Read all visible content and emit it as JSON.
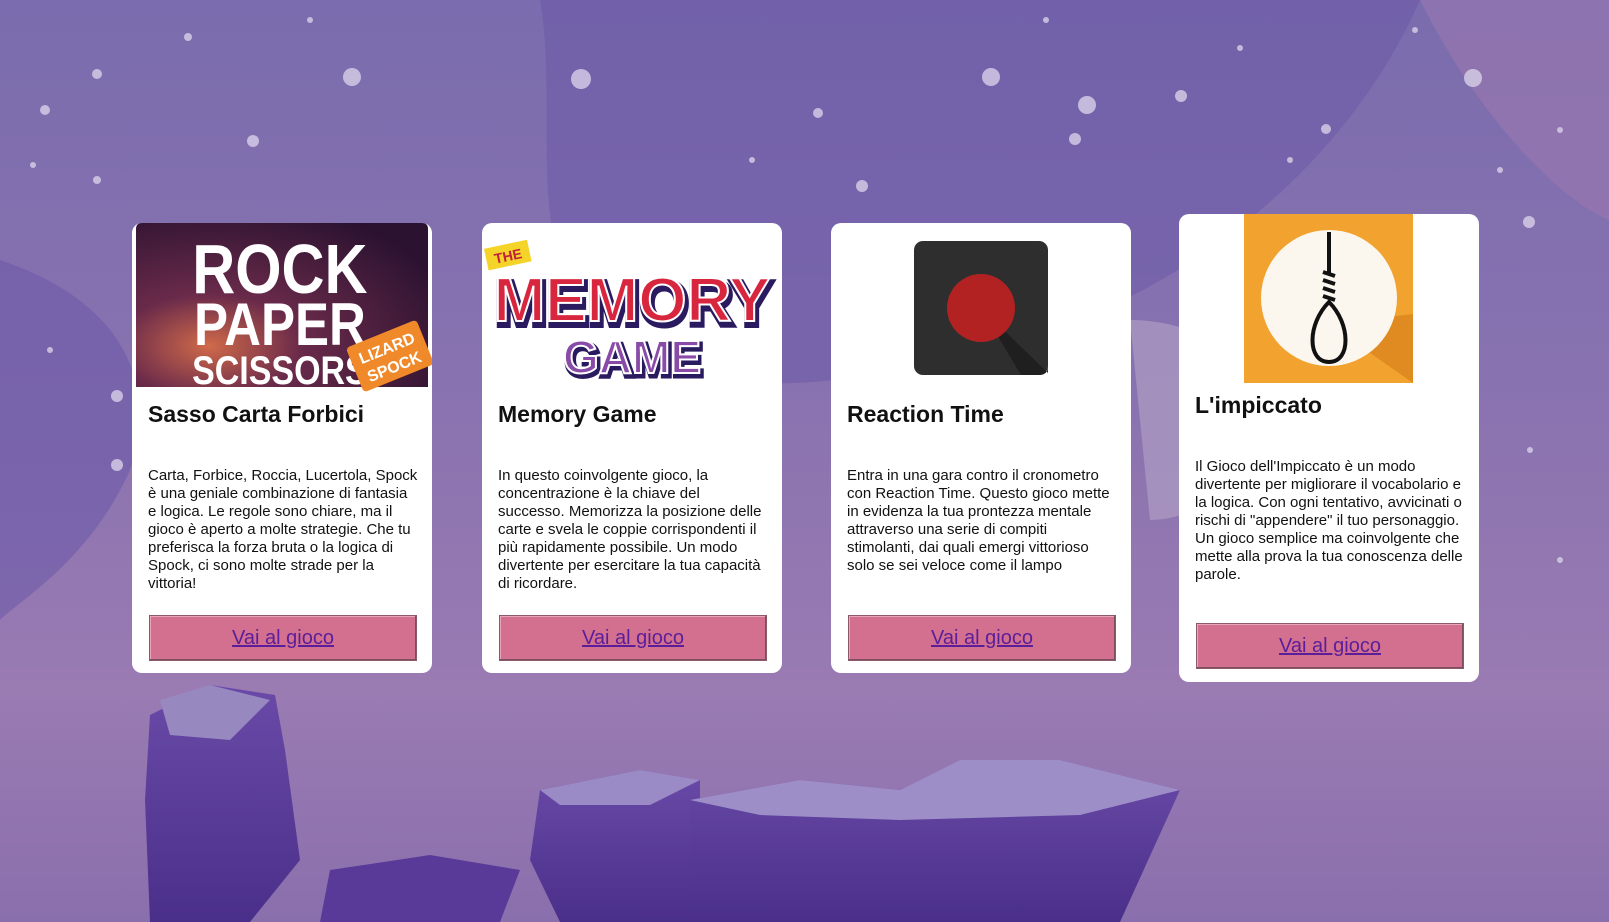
{
  "colors": {
    "background": "#8a73b0",
    "card": "#ffffff",
    "button": "#d4708f",
    "button_text": "#5a1e9a"
  },
  "games": [
    {
      "title": "Sasso Carta Forbici",
      "description": "Carta, Forbice, Roccia, Lucertola, Spock è una geniale combinazione di fantasia e logica. Le regole sono chiare, ma il gioco è aperto a molte strategie. Che tu preferisca la forza bruta o la logica di Spock, ci sono molte strade per la vittoria!",
      "button_label": "Vai al gioco",
      "image": {
        "icon": "rock-paper-scissors-logo",
        "line1": "ROCK",
        "line2": "PAPER",
        "line3": "SCISSORS",
        "badge1": "LIZARD",
        "badge2": "SPOCK"
      }
    },
    {
      "title": "Memory Game",
      "description": "In questo coinvolgente gioco, la concentrazione è la chiave del successo. Memorizza la posizione delle carte e svela le coppie corrispondenti il più rapidamente possibile. Un modo divertente per esercitare la tua capacità di ricordare.",
      "button_label": "Vai al gioco",
      "image": {
        "icon": "memory-game-logo",
        "tag": "THE",
        "word1": "MEMORY",
        "word2": "GAME"
      }
    },
    {
      "title": "Reaction Time",
      "description": "Entra in una gara contro il cronometro con Reaction Time. Questo gioco mette in evidenza la tua prontezza mentale attraverso una serie di compiti stimolanti, dai quali emergi vittorioso solo se sei veloce come il lampo",
      "button_label": "Vai al gioco",
      "image": {
        "icon": "record-button-icon"
      }
    },
    {
      "title": "L'impiccato",
      "description": "Il Gioco dell'Impiccato è un modo divertente per migliorare il vocabolario e la logica. Con ogni tentativo, avvicinati o rischi di \"appendere\" il tuo personaggio. Un gioco semplice ma coinvolgente che mette alla prova la tua conoscenza delle parole.",
      "button_label": "Vai al gioco",
      "image": {
        "icon": "noose-icon"
      }
    }
  ]
}
